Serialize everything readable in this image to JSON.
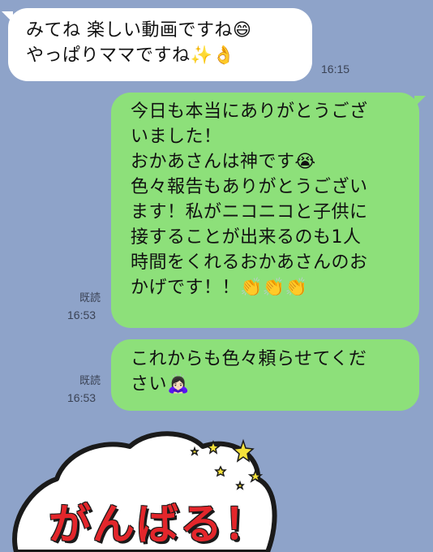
{
  "messages": [
    {
      "lines": [
        "みてね 楽しい動画ですね😄",
        "やっぱりママですね✨👌"
      ],
      "time": "16:15"
    },
    {
      "lines": [
        "今日も本当にありがとうござ",
        "いました！",
        "おかあさんは神です😭",
        "色々報告もありがとうござい",
        "ます！私がニコニコと子供に",
        "接することが出来るのも1人",
        "時間をくれるおかあさんのお",
        "かげです！！👏👏👏"
      ],
      "read": "既読",
      "time": "16:53"
    },
    {
      "lines": [
        "これからも色々頼らせてくだ",
        "さい🙇🏻‍♀️"
      ],
      "read": "既読",
      "time": "16:53"
    }
  ],
  "sticker": {
    "text": "がんばる！"
  },
  "colors": {
    "background": "#8ea3c9",
    "sent_bubble": "#8de07a",
    "received_bubble": "#ffffff"
  }
}
